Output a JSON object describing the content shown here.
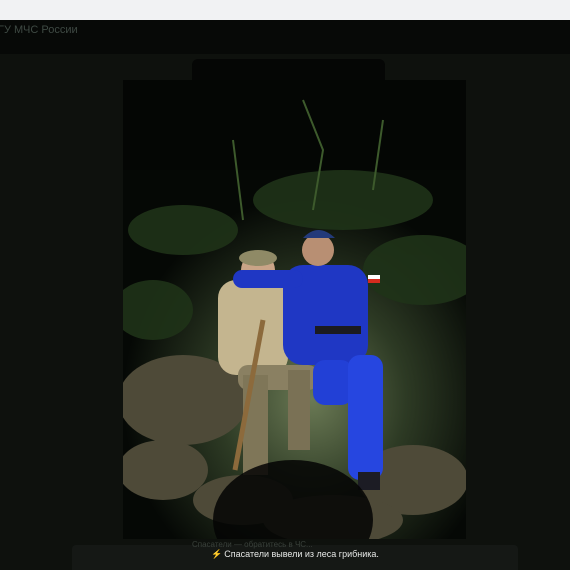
{
  "channel": {
    "title": "ГУ МЧС России",
    "subtitle": ""
  },
  "post": {
    "caption_icon": "lightning-icon",
    "caption": "Спасатели вывели из леса грибника.",
    "caption_ghost": "Спасатели — обратитесь в ЧС...",
    "accent_color": "#f5c518"
  },
  "photo": {
    "subject": "rescuer-and-mushroom-picker-night-forest"
  }
}
